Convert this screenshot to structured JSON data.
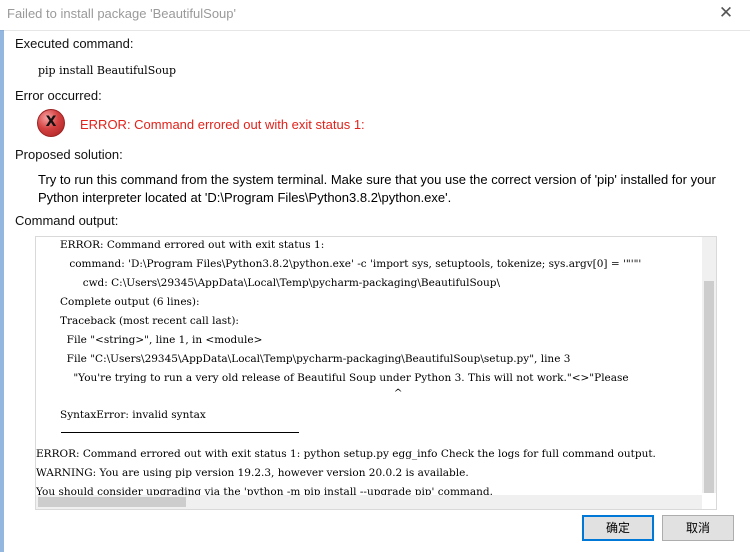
{
  "window": {
    "title": "Failed to install package 'BeautifulSoup'",
    "close_glyph": "✕"
  },
  "sections": {
    "executed_label": "Executed command:",
    "executed_cmd": "pip install BeautifulSoup",
    "error_label": "Error occurred:",
    "error_icon_glyph": "X",
    "error_text": "ERROR: Command errored out with exit status 1:",
    "solution_label": "Proposed solution:",
    "solution_text": "Try to run this command from the system terminal. Make sure that you use the correct version of 'pip' installed for your Python interpreter located at 'D:\\Program Files\\Python3.8.2\\python.exe'.",
    "output_label": "Command output:"
  },
  "output_lines": [
    "ERROR: Command errored out with exit status 1:",
    " command: 'D:\\Program Files\\Python3.8.2\\python.exe' -c 'import sys, setuptools, tokenize; sys.argv[0] = '\"'\"'",
    "     cwd: C:\\Users\\29345\\AppData\\Local\\Temp\\pycharm-packaging\\BeautifulSoup\\",
    "Complete output (6 lines):",
    "Traceback (most recent call last):",
    "  File \"<string>\", line 1, in <module>",
    "  File \"C:\\Users\\29345\\AppData\\Local\\Temp\\pycharm-packaging\\BeautifulSoup\\setup.py\", line 3",
    "    \"You're trying to run a very old release of Beautiful Soup under Python 3. This will not work.\"<>\"Please",
    "                                                                                                    ^",
    "SyntaxError: invalid syntax",
    "ERROR: Command errored out with exit status 1: python setup.py egg_info Check the logs for full command output.",
    "WARNING: You are using pip version 19.2.3, however version 20.0.2 is available.",
    "You should consider upgrading via the 'python -m pip install --upgrade pip' command."
  ],
  "buttons": {
    "ok": "确定",
    "cancel": "取消"
  },
  "colors": {
    "error_red": "#e0231b",
    "accent": "#0078d7"
  }
}
